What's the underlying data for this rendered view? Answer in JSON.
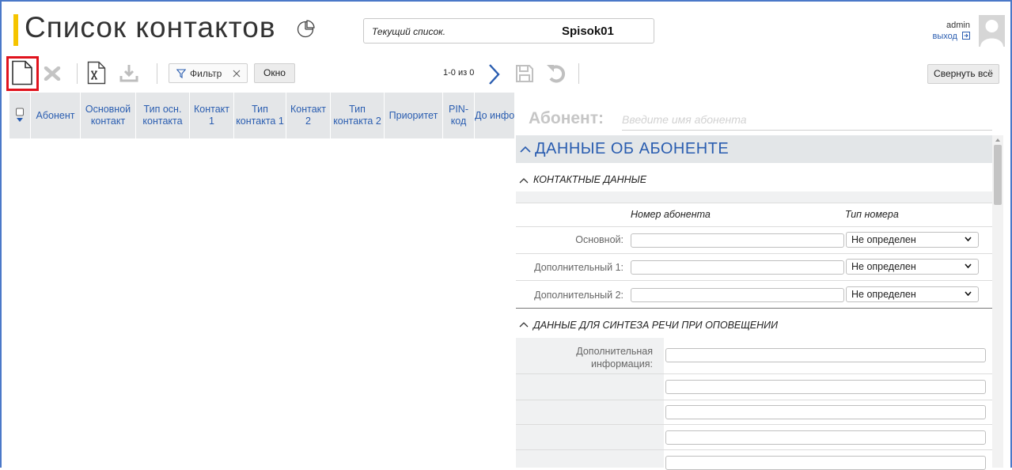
{
  "header": {
    "title": "Список контактов",
    "current_list_label": "Текущий список.",
    "current_list_value": "Spisok01",
    "user_name": "admin",
    "logout_label": "выход"
  },
  "toolbar": {
    "filter_label": "Фильтр",
    "window_label": "Окно",
    "pager_text": "1-0 из 0",
    "collapse_label": "Свернуть всё"
  },
  "table": {
    "columns": [
      {
        "label": "Абонент"
      },
      {
        "label": "Основной контакт"
      },
      {
        "label": "Тип осн. контакта"
      },
      {
        "label": "Контакт 1"
      },
      {
        "label": "Тип контакта 1"
      },
      {
        "label": "Контакт 2"
      },
      {
        "label": "Тип контакта 2"
      },
      {
        "label": "Приоритет"
      },
      {
        "label": "PIN-код"
      },
      {
        "label": "До инфор"
      }
    ]
  },
  "form": {
    "subscriber_label": "Абонент:",
    "subscriber_placeholder": "Введите имя абонента",
    "section_title": "ДАННЫЕ ОБ АБОНЕНТЕ",
    "contacts": {
      "title": "КОНТАКТНЫЕ ДАННЫЕ",
      "col_number": "Номер абонента",
      "col_type": "Тип номера",
      "rows": [
        {
          "label": "Основной:",
          "value": "",
          "type": "Не определен"
        },
        {
          "label": "Дополнительный 1:",
          "value": "",
          "type": "Не определен"
        },
        {
          "label": "Дополнительный 2:",
          "value": "",
          "type": "Не определен"
        }
      ]
    },
    "speech": {
      "title": "ДАННЫЕ ДЛЯ СИНТЕЗА РЕЧИ ПРИ ОПОВЕЩЕНИИ",
      "extra_info_label_1": "Дополнительная",
      "extra_info_label_2": "информация:"
    }
  },
  "colors": {
    "accent_blue": "#2a5db0",
    "title_bar": "#f5c400",
    "highlight_red": "#e0131d"
  }
}
